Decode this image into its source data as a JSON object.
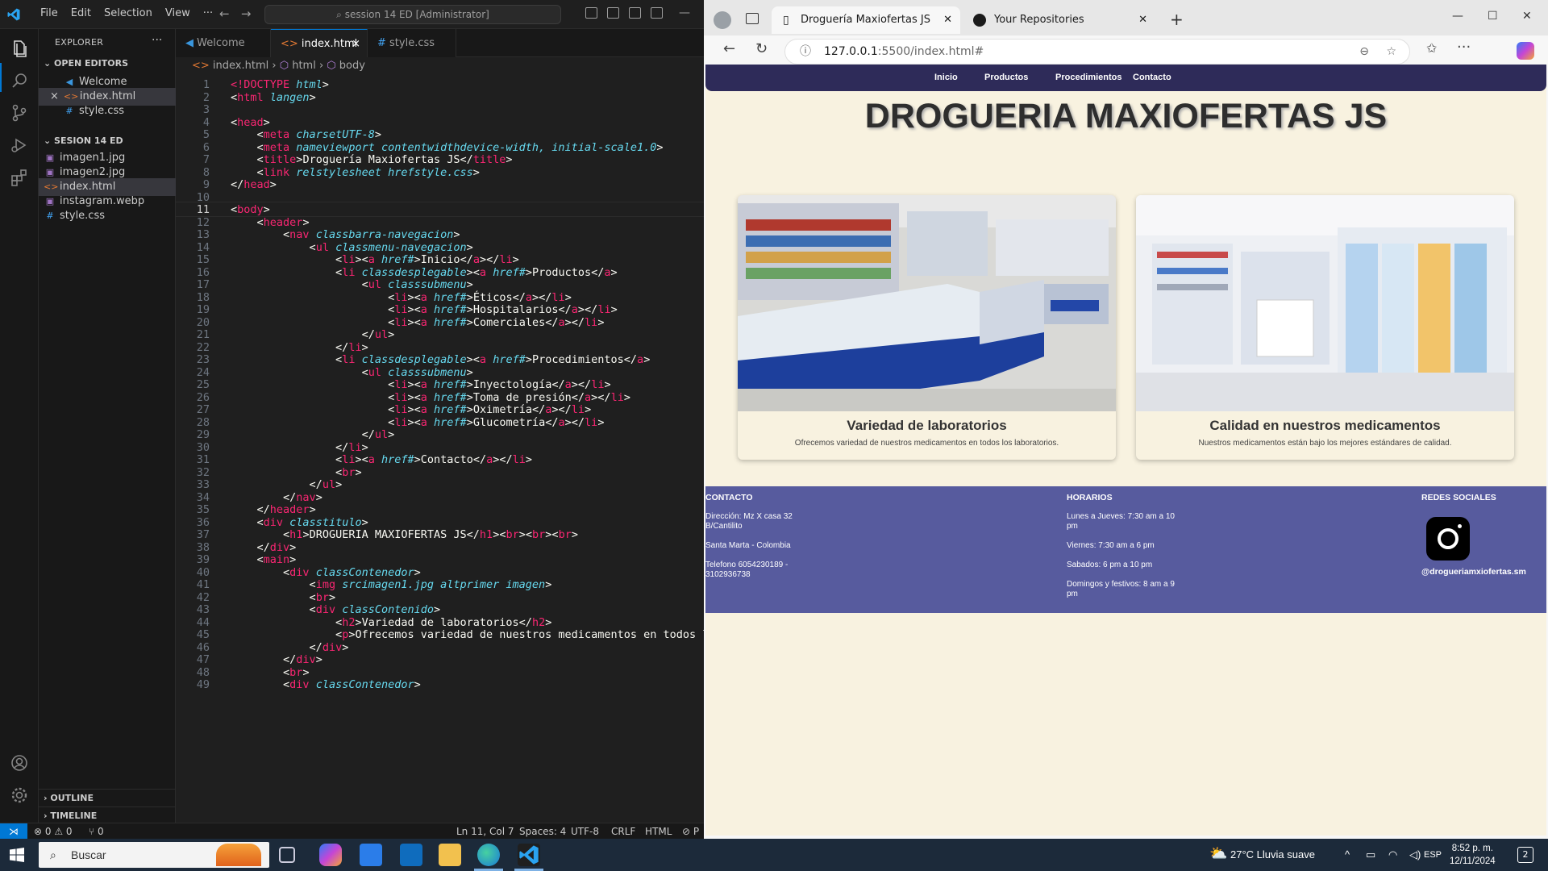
{
  "vscode": {
    "menu": [
      "File",
      "Edit",
      "Selection",
      "View",
      "···"
    ],
    "search": "session 14 ED [Administrator]",
    "explorer_title": "EXPLORER",
    "open_editors_title": "OPEN EDITORS",
    "open_editors": [
      {
        "name": "Welcome",
        "icon": "vscode-icon"
      },
      {
        "name": "index.html",
        "icon": "html-icon",
        "modified_close": "×"
      },
      {
        "name": "style.css",
        "icon": "css-icon"
      }
    ],
    "folder_title": "SESION 14 ED",
    "files": [
      "imagen1.jpg",
      "imagen2.jpg",
      "index.html",
      "instagram.webp",
      "style.css"
    ],
    "outline": "OUTLINE",
    "timeline": "TIMELINE",
    "tabs": [
      "Welcome",
      "index.html",
      "style.css"
    ],
    "breadcrumb": [
      "index.html",
      "html",
      "body"
    ],
    "lines": [
      "<!DOCTYPE html>",
      "<html lang=\"en\">",
      "",
      "<head>",
      "    <meta charset=\"UTF-8\">",
      "    <meta name=\"viewport\" content=\"width=device-width, initial-scale=1.0\">",
      "    <title>Droguería Maxiofertas JS</title>",
      "    <link rel=\"stylesheet\" href=\"style.css\">",
      "</head>",
      "",
      "<body>",
      "    <header>",
      "        <nav class=\"barra-navegacion\">",
      "            <ul class=\"menu-navegacion\">",
      "                <li><a href=\"#\">Inicio</a></li>",
      "                <li class=\"desplegable\"><a href=\"#\">Productos</a>",
      "                    <ul class=\"submenu\">",
      "                        <li><a href=\"#\">Éticos</a></li>",
      "                        <li><a href=\"#\">Hospitalarios</a></li>",
      "                        <li><a href=\"#\">Comerciales</a></li>",
      "                    </ul>",
      "                </li>",
      "                <li class=\"desplegable\"><a href=\"#\">Procedimientos</a>",
      "                    <ul class=\"submenu\">",
      "                        <li><a href=\"#\">Inyectología</a></li>",
      "                        <li><a href=\"#\">Toma de presión</a></li>",
      "                        <li><a href=\"#\">Oximetría</a></li>",
      "                        <li><a href=\"#\">Glucometría</a></li>",
      "                    </ul>",
      "                </li>",
      "                <li><a href=\"#\">Contacto</a></li>",
      "                <br>",
      "            </ul>",
      "        </nav>",
      "    </header>",
      "    <div class=\"titulo\">",
      "        <h1>DROGUERIA MAXIOFERTAS JS</h1><br><br><br>",
      "    </div>",
      "    <main>",
      "        <div class=\"Contenedor\">",
      "            <img src=\"imagen1.jpg\" alt=\"primer imagen\">",
      "            <br>",
      "            <div class=\"Contenido\">",
      "                <h2>Variedad de laboratorios</h2>",
      "                <p>Ofrecemos variedad de nuestros medicamentos en todos los",
      "            </div>",
      "        </div>",
      "        <br>",
      "        <div class=\"Contenedor\">"
    ],
    "current_line": 11,
    "status": {
      "problems": "⊗ 0 ⚠ 0",
      "ports": "⑂ 0",
      "position": "Ln 11, Col 7",
      "spaces": "Spaces: 4",
      "encoding": "UTF-8",
      "eol": "CRLF",
      "language": "HTML",
      "prettier": "⊘ P"
    }
  },
  "browser": {
    "tabs": [
      {
        "title": "Droguería Maxiofertas JS",
        "icon": "page-icon"
      },
      {
        "title": "Your Repositories",
        "icon": "github-icon"
      }
    ],
    "url_host": "127.0.0.1",
    "url_rest": ":5500/index.html#"
  },
  "site": {
    "nav": [
      "Inicio",
      "Productos",
      "Procedimientos",
      "Contacto"
    ],
    "title": "DROGUERIA MAXIOFERTAS JS",
    "cards": [
      {
        "title": "Variedad de laboratorios",
        "text": "Ofrecemos variedad de nuestros medicamentos en todos los laboratorios."
      },
      {
        "title": "Calidad en nuestros medicamentos",
        "text": "Nuestros medicamentos están bajo los mejores estándares de calidad."
      }
    ],
    "footer": {
      "contact_title": "CONTACTO",
      "contact": [
        "Dirección: Mz X casa 32 B/Cantilito",
        "Santa Marta - Colombia",
        "Telefono 6054230189 - 3102936738"
      ],
      "hours_title": "HORARIOS",
      "hours": [
        "Lunes a Jueves: 7:30 am a 10 pm",
        "Viernes: 7:30 am a 6 pm",
        "Sabados: 6 pm a 10 pm",
        "Domingos y festivos: 8 am a 9 pm"
      ],
      "social_title": "REDES SOCIALES",
      "handle": "@drogueriamxiofertas.sm"
    }
  },
  "taskbar": {
    "search": "Buscar",
    "weather": "27°C  Lluvia suave",
    "lang": "ESP",
    "time": "8:52 p. m.",
    "date": "12/11/2024",
    "notifications": "2"
  },
  "colors": {
    "site_nav": "#2e2b59",
    "site_bg": "#f8f2e0",
    "footer": "#575b9e",
    "accent": "#0078d4"
  }
}
